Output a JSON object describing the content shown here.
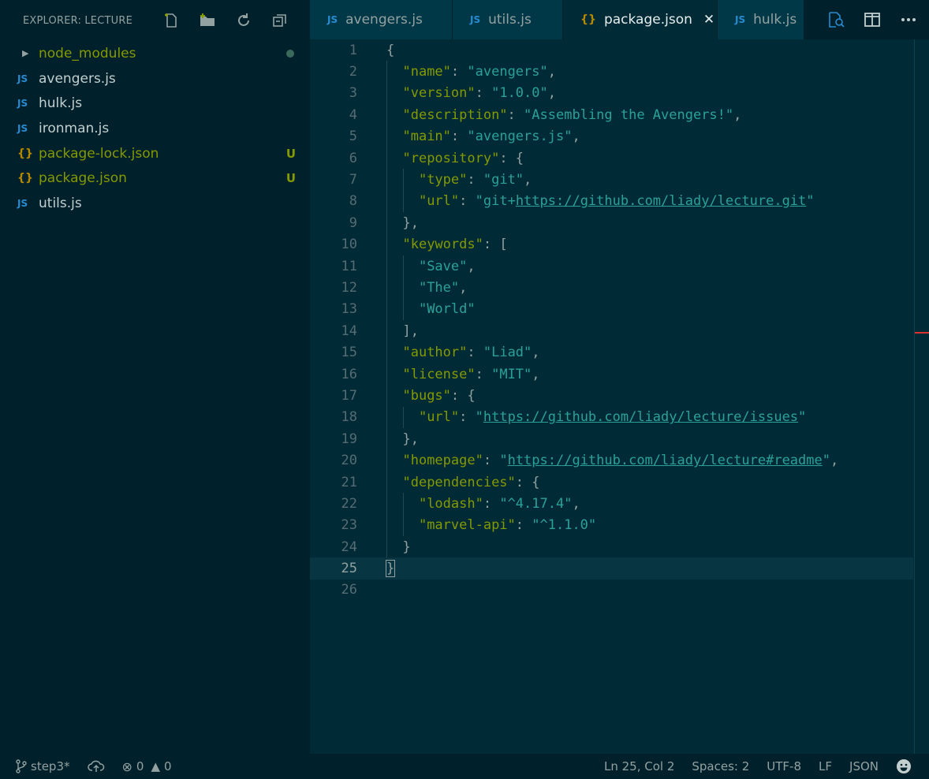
{
  "sidebar": {
    "title": "EXPLORER: LECTURE",
    "actions": [
      {
        "name": "new-file-icon"
      },
      {
        "name": "new-folder-icon"
      },
      {
        "name": "refresh-icon"
      },
      {
        "name": "collapse-all-icon"
      }
    ],
    "items": [
      {
        "label": "node_modules",
        "type": "folder",
        "decoration": "dot"
      },
      {
        "label": "avengers.js",
        "type": "js",
        "badge": ""
      },
      {
        "label": "hulk.js",
        "type": "js",
        "badge": ""
      },
      {
        "label": "ironman.js",
        "type": "js",
        "badge": ""
      },
      {
        "label": "package-lock.json",
        "type": "json",
        "badge": "U"
      },
      {
        "label": "package.json",
        "type": "json",
        "badge": "U"
      },
      {
        "label": "utils.js",
        "type": "js",
        "badge": ""
      }
    ],
    "icon_labels": {
      "js": "JS",
      "json": "{}"
    }
  },
  "tabs": [
    {
      "label": "avengers.js",
      "icon": "JS",
      "active": false
    },
    {
      "label": "utils.js",
      "icon": "JS",
      "active": false
    },
    {
      "label": "package.json",
      "icon": "{}",
      "active": true,
      "close": "✕"
    },
    {
      "label": "hulk.js",
      "icon": "JS",
      "active": false
    }
  ],
  "editor": {
    "line_numbers": [
      "1",
      "2",
      "3",
      "4",
      "5",
      "6",
      "7",
      "8",
      "9",
      "10",
      "11",
      "12",
      "13",
      "14",
      "15",
      "16",
      "17",
      "18",
      "19",
      "20",
      "21",
      "22",
      "23",
      "24",
      "25",
      "26"
    ],
    "current_line": 25
  },
  "status": {
    "branch": "step3*",
    "errors": "0",
    "warnings": "0",
    "position": "Ln 25, Col 2",
    "spaces": "Spaces: 2",
    "encoding": "UTF-8",
    "eol": "LF",
    "language": "JSON"
  },
  "colors": {
    "background": "#002b36",
    "sidebar": "#00212b",
    "keyword": "#859900",
    "string": "#2aa198",
    "js_icon": "#268bd2",
    "json_icon": "#b58900"
  }
}
